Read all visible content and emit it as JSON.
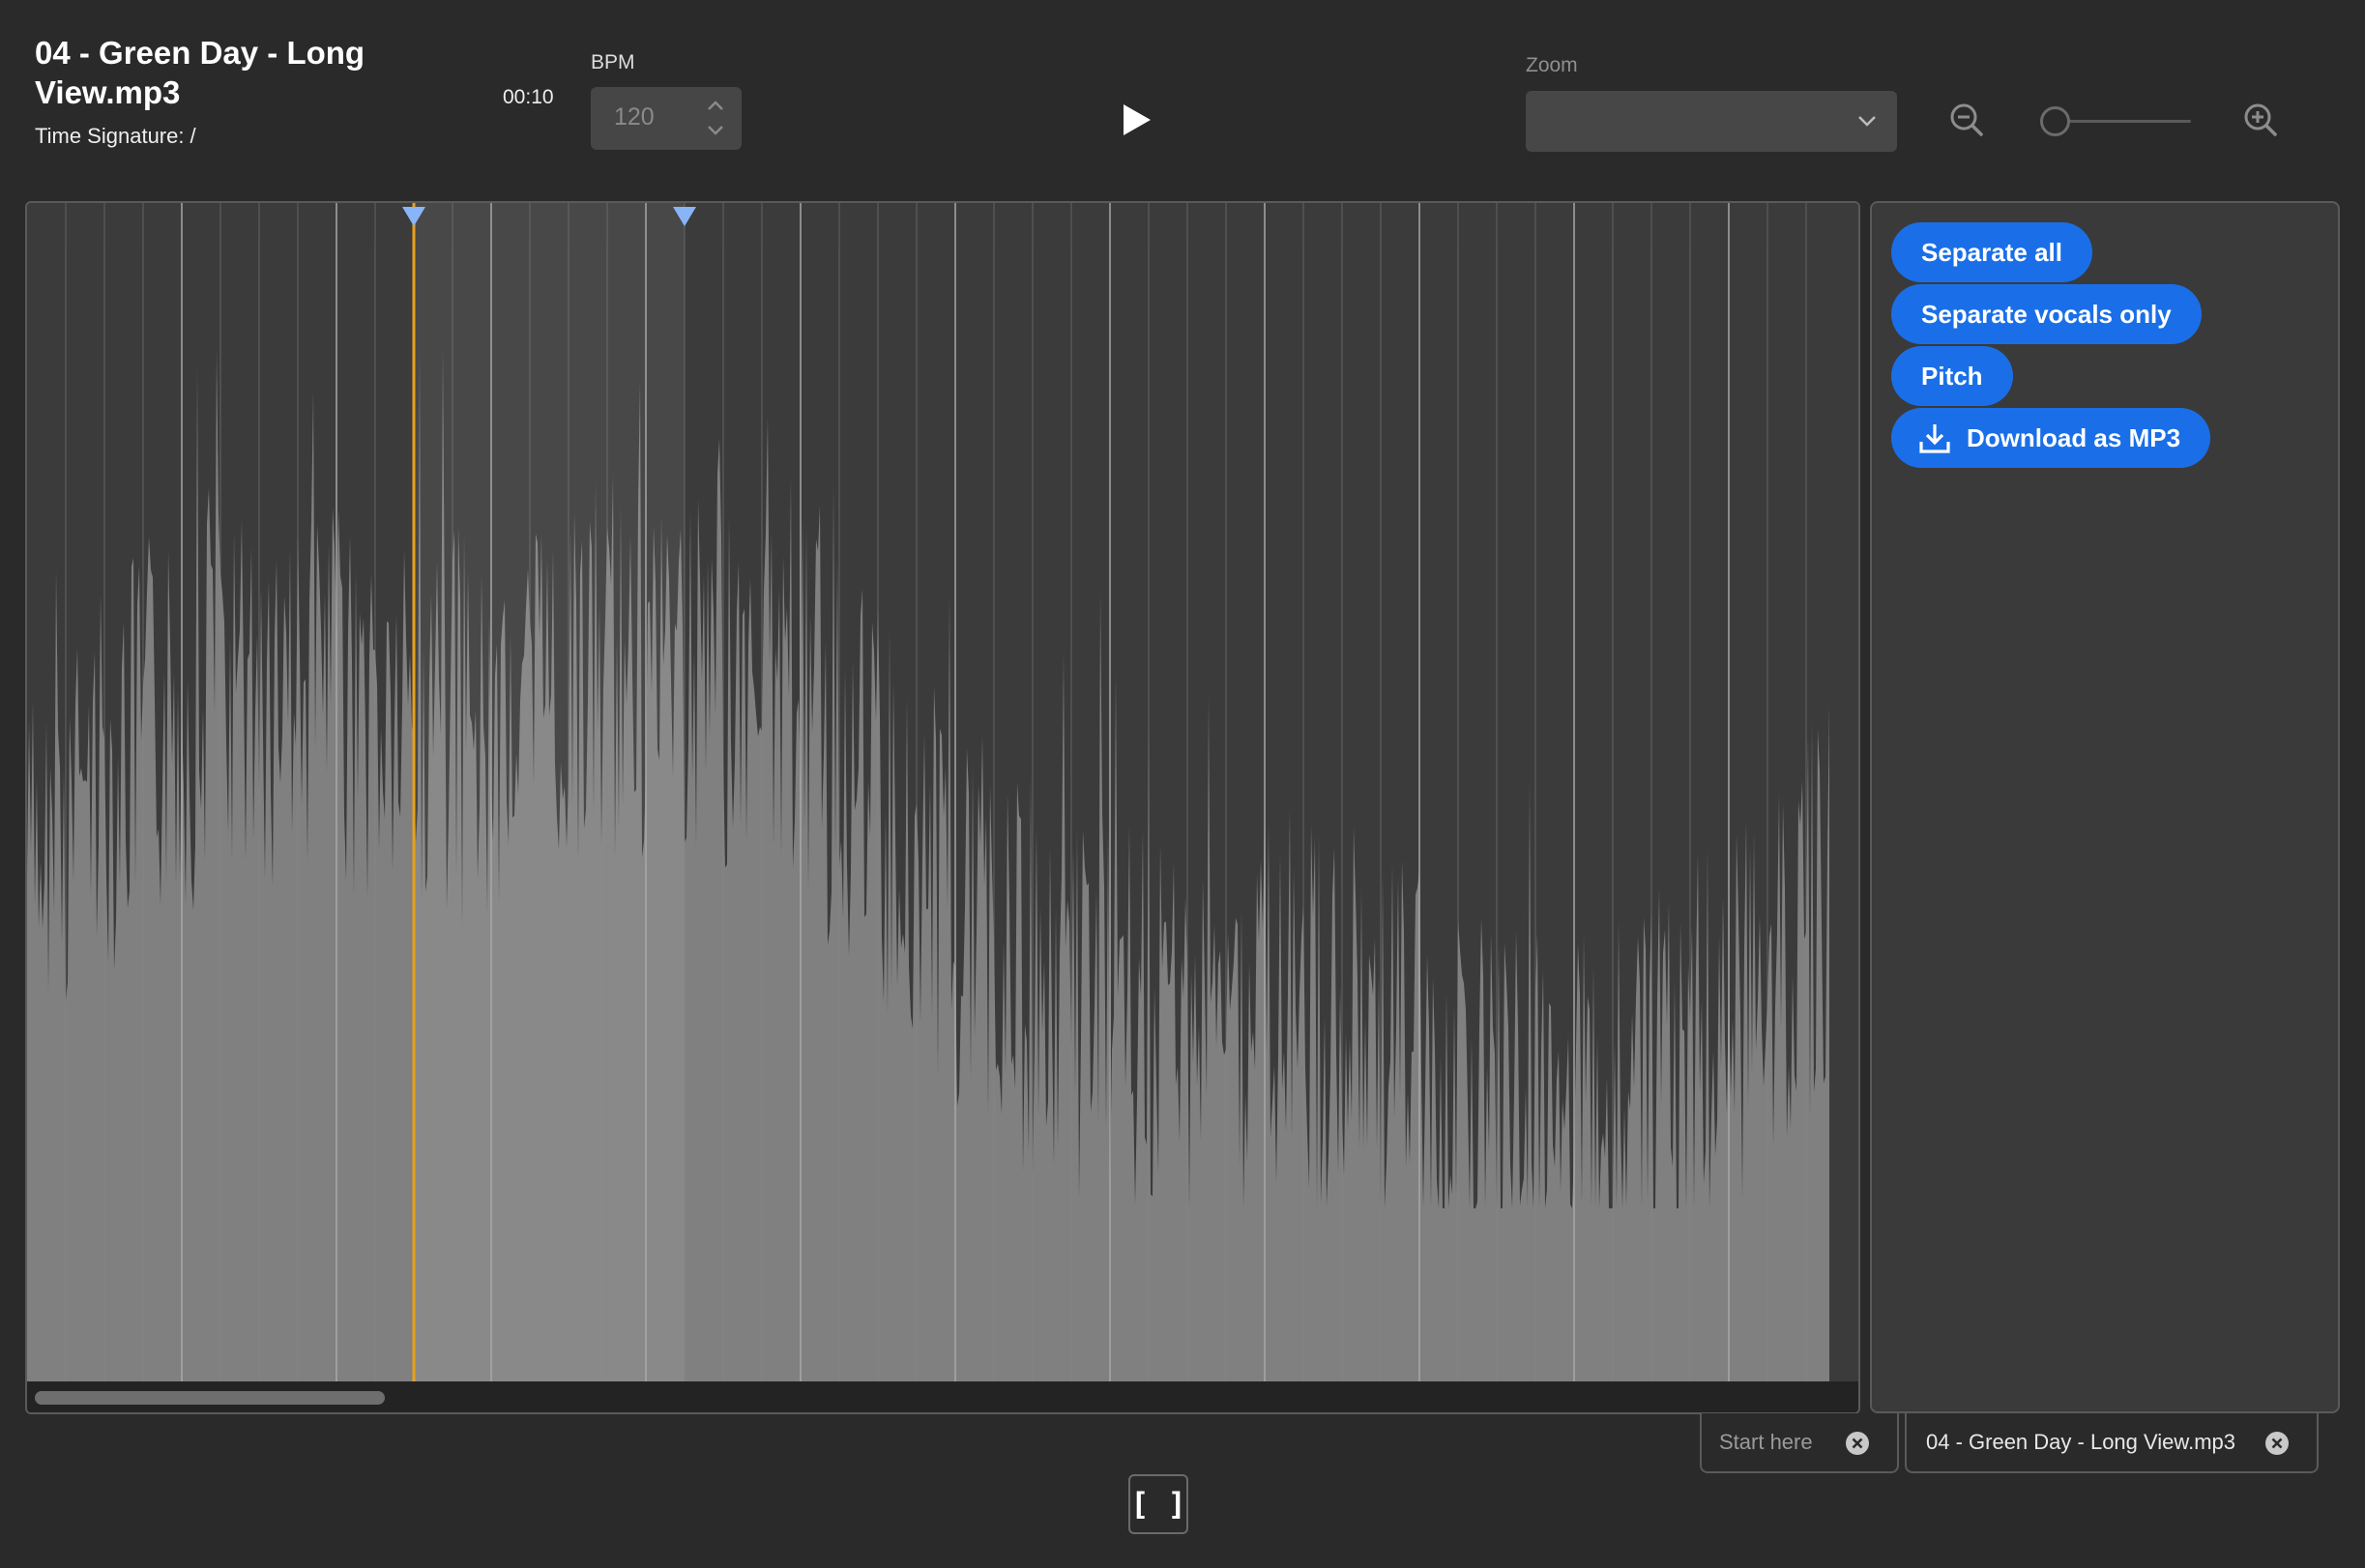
{
  "header": {
    "file_title": "04 - Green Day - Long View.mp3",
    "time_signature_label": "Time Signature:",
    "time_signature_value": "/",
    "current_time": "00:10"
  },
  "bpm": {
    "label": "BPM",
    "value": "120"
  },
  "transport": {
    "play_icon": "play-icon"
  },
  "zoom": {
    "label": "Zoom",
    "selected": "",
    "zoom_out_icon": "zoom-out-icon",
    "zoom_in_icon": "zoom-in-icon",
    "slider_level": 0.0
  },
  "editor": {
    "playhead_color": "#e8a21a",
    "marker_color": "#8ab4f8",
    "waveform_color": "#808080",
    "grid_line_color": "#888888",
    "scroll_position": 0.0
  },
  "actions": {
    "separate_all": "Separate all",
    "separate_vocals": "Separate vocals only",
    "pitch": "Pitch",
    "download": "Download as MP3",
    "accent_color": "#1a6fe8"
  },
  "tabs": [
    {
      "label": "Start here",
      "close_icon": "close-circle-icon"
    },
    {
      "label": "04 - Green Day - Long View.mp3",
      "close_icon": "close-circle-icon"
    }
  ],
  "bottom": {
    "region_button_label": "[ ]"
  }
}
